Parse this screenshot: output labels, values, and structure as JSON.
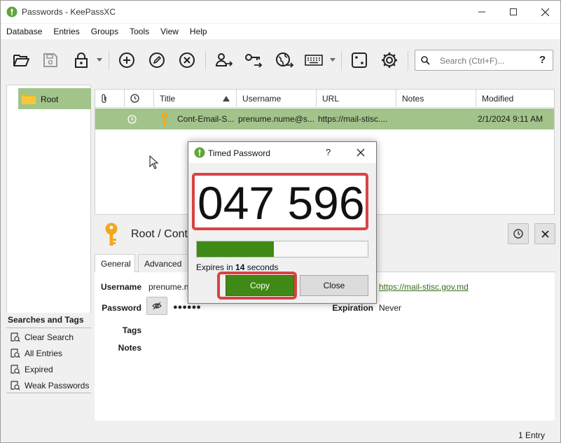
{
  "window": {
    "title": "Passwords - KeePassXC"
  },
  "menu": [
    "Database",
    "Entries",
    "Groups",
    "Tools",
    "View",
    "Help"
  ],
  "toolbar": {
    "icons": [
      "open-database-icon",
      "save-database-icon",
      "lock-database-icon",
      "add-entry-icon",
      "edit-entry-icon",
      "delete-entry-icon",
      "copy-username-icon",
      "copy-password-icon",
      "copy-url-icon",
      "autotype-icon",
      "password-generator-icon",
      "settings-icon"
    ],
    "search_placeholder": "Search (Ctrl+F)...",
    "search_help": "?"
  },
  "groups": {
    "root": "Root"
  },
  "searches": {
    "header": "Searches and Tags",
    "items": [
      "Clear Search",
      "All Entries",
      "Expired",
      "Weak Passwords"
    ]
  },
  "table": {
    "columns": [
      "Title",
      "Username",
      "URL",
      "Notes",
      "Modified"
    ],
    "rows": [
      {
        "title": "Cont-Email-S...",
        "username": "prenume.nume@s...",
        "url": "https://mail-stisc....",
        "notes": "",
        "modified": "2/1/2024 9:11 AM"
      }
    ]
  },
  "details": {
    "breadcrumb": "Root / Cont",
    "tabs": [
      "General",
      "Advanced"
    ],
    "labels": {
      "username": "Username",
      "password": "Password",
      "tags": "Tags",
      "notes": "Notes",
      "expiration": "Expiration"
    },
    "username_value": "prenume.n",
    "password_value": "●●●●●●",
    "url_value": "https://mail-stisc.gov.md",
    "expiration_value": "Never"
  },
  "status": {
    "count": "1 Entry"
  },
  "dialog": {
    "title": "Timed Password",
    "help": "?",
    "code": "047 596",
    "progress": 0.45,
    "expires_prefix": "Expires in ",
    "expires_seconds": "14",
    "expires_suffix": " seconds",
    "copy_label": "Copy",
    "close_label": "Close"
  },
  "colors": {
    "accent_green": "#3f8a16",
    "selection_green": "#a2c48b",
    "highlight_red": "#d84343",
    "key_gold": "#f2a81d"
  }
}
